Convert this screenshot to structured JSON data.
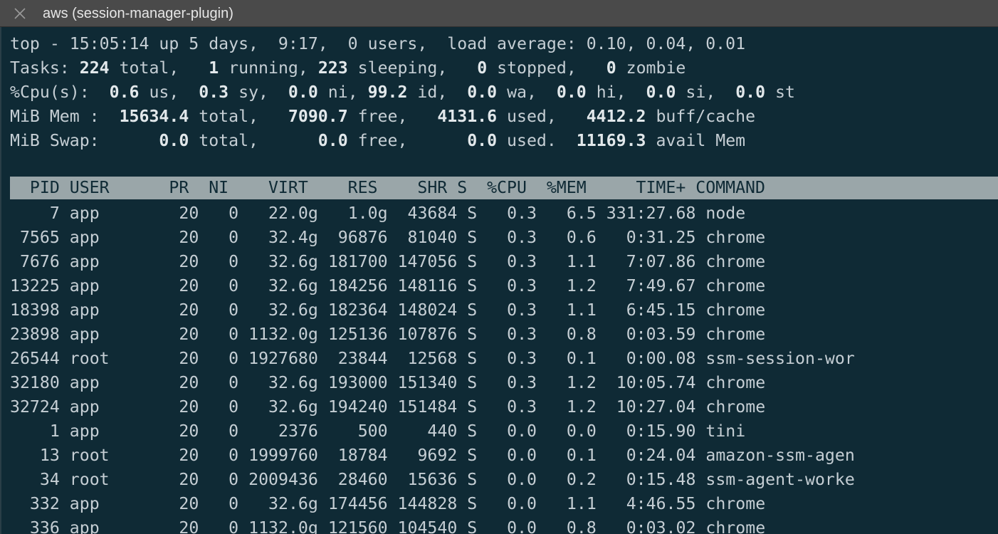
{
  "window": {
    "title": "aws (session-manager-plugin)",
    "close_icon": "close-icon"
  },
  "summary": {
    "top": {
      "prefix": "top - ",
      "time": "15:05:14",
      "uptime": " up 5 days,  9:17,  0 users,  load average: ",
      "load": "0.10, 0.04, 0.01"
    },
    "tasks": {
      "label": "Tasks: ",
      "total": "224",
      "total_label": " total,   ",
      "running": "1",
      "running_label": " running, ",
      "sleeping": "223",
      "sleeping_label": " sleeping,   ",
      "stopped": "0",
      "stopped_label": " stopped,   ",
      "zombie": "0",
      "zombie_label": " zombie"
    },
    "cpu": {
      "label": "%Cpu(s):  ",
      "us": "0.6",
      "us_label": " us,  ",
      "sy": "0.3",
      "sy_label": " sy,  ",
      "ni": "0.0",
      "ni_label": " ni, ",
      "id": "99.2",
      "id_label": " id,  ",
      "wa": "0.0",
      "wa_label": " wa,  ",
      "hi": "0.0",
      "hi_label": " hi,  ",
      "si": "0.0",
      "si_label": " si,  ",
      "st": "0.0",
      "st_label": " st"
    },
    "mem": {
      "label": "MiB Mem :  ",
      "total": "15634.4",
      "total_label": " total,   ",
      "free": "7090.7",
      "free_label": " free,   ",
      "used": "4131.6",
      "used_label": " used,   ",
      "buff": "4412.2",
      "buff_label": " buff/cache"
    },
    "swap": {
      "label": "MiB Swap:      ",
      "total": "0.0",
      "total_label": " total,      ",
      "free": "0.0",
      "free_label": " free,      ",
      "used": "0.0",
      "used_label": " used.  ",
      "avail": "11169.3",
      "avail_label": " avail Mem"
    }
  },
  "table": {
    "columns": [
      "PID",
      "USER",
      "PR",
      "NI",
      "VIRT",
      "RES",
      "SHR",
      "S",
      "%CPU",
      "%MEM",
      "TIME+",
      "COMMAND"
    ],
    "header_line": "  PID USER      PR  NI    VIRT    RES    SHR S  %CPU  %MEM     TIME+ COMMAND",
    "rows": [
      {
        "pid": "7",
        "user": "app",
        "pr": "20",
        "ni": "0",
        "virt": "22.0g",
        "res": "1.0g",
        "shr": "43684",
        "s": "S",
        "cpu": "0.3",
        "mem": "6.5",
        "time": "331:27.68",
        "command": "node"
      },
      {
        "pid": "7565",
        "user": "app",
        "pr": "20",
        "ni": "0",
        "virt": "32.4g",
        "res": "96876",
        "shr": "81040",
        "s": "S",
        "cpu": "0.3",
        "mem": "0.6",
        "time": "0:31.25",
        "command": "chrome"
      },
      {
        "pid": "7676",
        "user": "app",
        "pr": "20",
        "ni": "0",
        "virt": "32.6g",
        "res": "181700",
        "shr": "147056",
        "s": "S",
        "cpu": "0.3",
        "mem": "1.1",
        "time": "7:07.86",
        "command": "chrome"
      },
      {
        "pid": "13225",
        "user": "app",
        "pr": "20",
        "ni": "0",
        "virt": "32.6g",
        "res": "184256",
        "shr": "148116",
        "s": "S",
        "cpu": "0.3",
        "mem": "1.2",
        "time": "7:49.67",
        "command": "chrome"
      },
      {
        "pid": "18398",
        "user": "app",
        "pr": "20",
        "ni": "0",
        "virt": "32.6g",
        "res": "182364",
        "shr": "148024",
        "s": "S",
        "cpu": "0.3",
        "mem": "1.1",
        "time": "6:45.15",
        "command": "chrome"
      },
      {
        "pid": "23898",
        "user": "app",
        "pr": "20",
        "ni": "0",
        "virt": "1132.0g",
        "res": "125136",
        "shr": "107876",
        "s": "S",
        "cpu": "0.3",
        "mem": "0.8",
        "time": "0:03.59",
        "command": "chrome"
      },
      {
        "pid": "26544",
        "user": "root",
        "pr": "20",
        "ni": "0",
        "virt": "1927680",
        "res": "23844",
        "shr": "12568",
        "s": "S",
        "cpu": "0.3",
        "mem": "0.1",
        "time": "0:00.08",
        "command": "ssm-session-wor"
      },
      {
        "pid": "32180",
        "user": "app",
        "pr": "20",
        "ni": "0",
        "virt": "32.6g",
        "res": "193000",
        "shr": "151340",
        "s": "S",
        "cpu": "0.3",
        "mem": "1.2",
        "time": "10:05.74",
        "command": "chrome"
      },
      {
        "pid": "32724",
        "user": "app",
        "pr": "20",
        "ni": "0",
        "virt": "32.6g",
        "res": "194240",
        "shr": "151484",
        "s": "S",
        "cpu": "0.3",
        "mem": "1.2",
        "time": "10:27.04",
        "command": "chrome"
      },
      {
        "pid": "1",
        "user": "app",
        "pr": "20",
        "ni": "0",
        "virt": "2376",
        "res": "500",
        "shr": "440",
        "s": "S",
        "cpu": "0.0",
        "mem": "0.0",
        "time": "0:15.90",
        "command": "tini"
      },
      {
        "pid": "13",
        "user": "root",
        "pr": "20",
        "ni": "0",
        "virt": "1999760",
        "res": "18784",
        "shr": "9692",
        "s": "S",
        "cpu": "0.0",
        "mem": "0.1",
        "time": "0:24.04",
        "command": "amazon-ssm-agen"
      },
      {
        "pid": "34",
        "user": "root",
        "pr": "20",
        "ni": "0",
        "virt": "2009436",
        "res": "28460",
        "shr": "15636",
        "s": "S",
        "cpu": "0.0",
        "mem": "0.2",
        "time": "0:15.48",
        "command": "ssm-agent-worke"
      },
      {
        "pid": "332",
        "user": "app",
        "pr": "20",
        "ni": "0",
        "virt": "32.6g",
        "res": "174456",
        "shr": "144828",
        "s": "S",
        "cpu": "0.0",
        "mem": "1.1",
        "time": "4:46.55",
        "command": "chrome"
      },
      {
        "pid": "336",
        "user": "app",
        "pr": "20",
        "ni": "0",
        "virt": "1132.0g",
        "res": "121560",
        "shr": "104540",
        "s": "S",
        "cpu": "0.0",
        "mem": "0.8",
        "time": "0:03.02",
        "command": "chrome"
      }
    ]
  },
  "colors": {
    "tabbar_bg": "#4a4a4a",
    "terminal_bg": "#0f2a35",
    "text": "#c5ced4",
    "bold_text": "#e2e8eb",
    "header_band": "#9aa6a9"
  }
}
